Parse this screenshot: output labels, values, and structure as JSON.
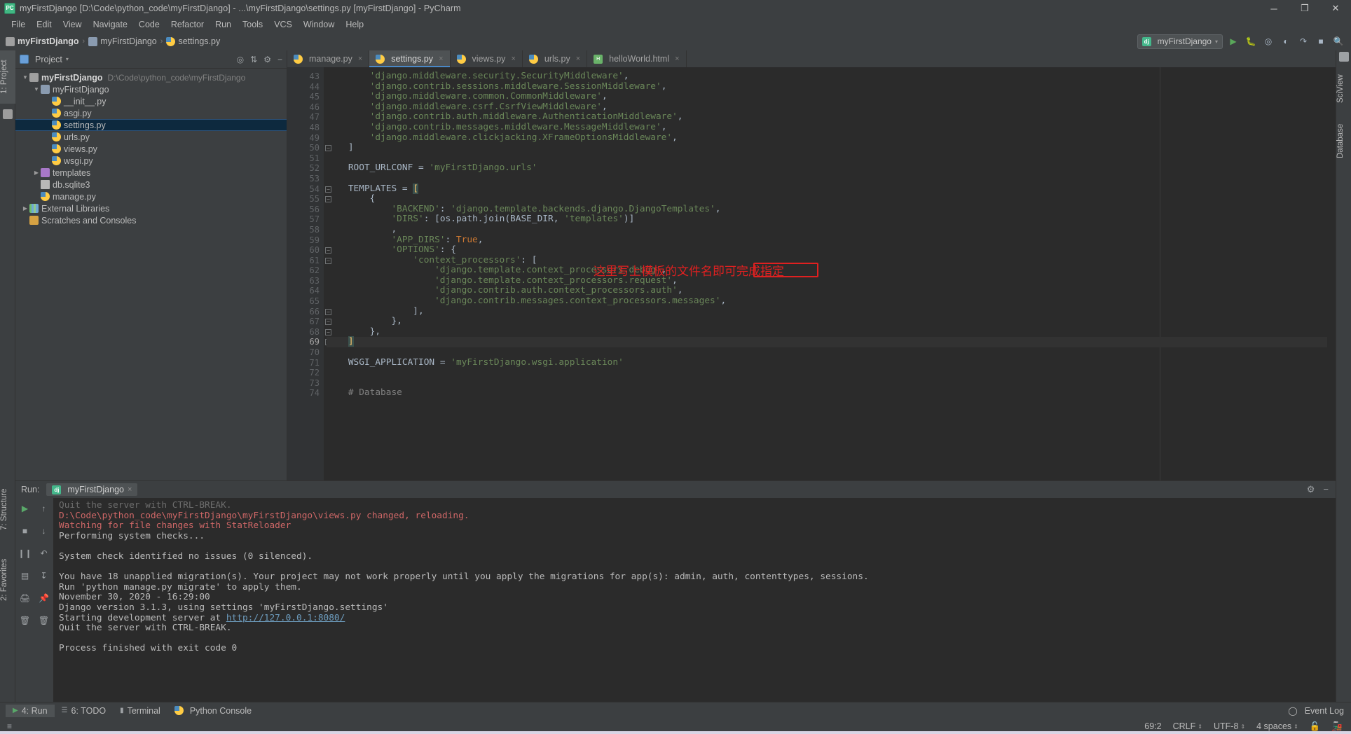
{
  "window": {
    "title": "myFirstDjango [D:\\Code\\python_code\\myFirstDjango] - ...\\myFirstDjango\\settings.py [myFirstDjango] - PyCharm",
    "app_icon": "pycharm-icon",
    "minimize": "─",
    "maximize": "❐",
    "close": "✕"
  },
  "menu": {
    "items": [
      "File",
      "Edit",
      "View",
      "Navigate",
      "Code",
      "Refactor",
      "Run",
      "Tools",
      "VCS",
      "Window",
      "Help"
    ]
  },
  "breadcrumb": {
    "items": [
      {
        "label": "myFirstDjango",
        "icon": "folder-icon"
      },
      {
        "label": "myFirstDjango",
        "icon": "module-icon"
      },
      {
        "label": "settings.py",
        "icon": "python-file-icon"
      }
    ],
    "separator": "›"
  },
  "toolbar_right": {
    "run_config": "myFirstDjango",
    "run_config_icon": "django-icon",
    "dropdown_caret": "▾",
    "icons": [
      "run-icon",
      "debug-icon",
      "coverage-icon",
      "profile-icon",
      "attach-icon",
      "stop-icon",
      "search-everywhere-icon"
    ]
  },
  "left_strip": {
    "tabs": [
      {
        "label": "1: Project",
        "selected": true
      },
      {
        "label": "2: Favorites",
        "selected": false
      },
      {
        "label": "7: Structure",
        "selected": false
      }
    ]
  },
  "right_strip": {
    "tabs": [
      {
        "label": "SciView",
        "selected": false
      },
      {
        "label": "Database",
        "selected": false
      }
    ]
  },
  "project_panel": {
    "title": "Project",
    "title_caret": "▾",
    "header_icons": [
      "target-icon",
      "collapse-all-icon",
      "settings-icon",
      "hide-icon"
    ],
    "tree": [
      {
        "indent": 0,
        "arrow": "▼",
        "icon": "folder-icon",
        "label": "myFirstDjango",
        "bold": true,
        "path": "D:\\Code\\python_code\\myFirstDjango",
        "selected": false
      },
      {
        "indent": 1,
        "arrow": "▼",
        "icon": "module-icon",
        "label": "myFirstDjango",
        "bold": false,
        "path": "",
        "selected": false
      },
      {
        "indent": 2,
        "arrow": "",
        "icon": "python-file-icon",
        "label": "__init__.py",
        "bold": false,
        "path": "",
        "selected": false
      },
      {
        "indent": 2,
        "arrow": "",
        "icon": "python-file-icon",
        "label": "asgi.py",
        "bold": false,
        "path": "",
        "selected": false
      },
      {
        "indent": 2,
        "arrow": "",
        "icon": "python-file-icon",
        "label": "settings.py",
        "bold": false,
        "path": "",
        "selected": true
      },
      {
        "indent": 2,
        "arrow": "",
        "icon": "python-file-icon",
        "label": "urls.py",
        "bold": false,
        "path": "",
        "selected": false
      },
      {
        "indent": 2,
        "arrow": "",
        "icon": "python-file-icon",
        "label": "views.py",
        "bold": false,
        "path": "",
        "selected": false
      },
      {
        "indent": 2,
        "arrow": "",
        "icon": "python-file-icon",
        "label": "wsgi.py",
        "bold": false,
        "path": "",
        "selected": false
      },
      {
        "indent": 1,
        "arrow": "▶",
        "icon": "templates-folder-icon",
        "label": "templates",
        "bold": false,
        "path": "",
        "selected": false
      },
      {
        "indent": 1,
        "arrow": "",
        "icon": "database-file-icon",
        "label": "db.sqlite3",
        "bold": false,
        "path": "",
        "selected": false
      },
      {
        "indent": 1,
        "arrow": "",
        "icon": "python-file-icon",
        "label": "manage.py",
        "bold": false,
        "path": "",
        "selected": false
      },
      {
        "indent": 0,
        "arrow": "▶",
        "icon": "library-icon",
        "label": "External Libraries",
        "bold": false,
        "path": "",
        "selected": false
      },
      {
        "indent": 0,
        "arrow": "",
        "icon": "scratches-icon",
        "label": "Scratches and Consoles",
        "bold": false,
        "path": "",
        "selected": false
      }
    ]
  },
  "editor": {
    "tabs": [
      {
        "label": "manage.py",
        "icon": "python-file-icon",
        "active": false,
        "close": "×"
      },
      {
        "label": "settings.py",
        "icon": "python-file-icon",
        "active": true,
        "close": "×"
      },
      {
        "label": "views.py",
        "icon": "python-file-icon",
        "active": false,
        "close": "×"
      },
      {
        "label": "urls.py",
        "icon": "python-file-icon",
        "active": false,
        "close": "×"
      },
      {
        "label": "helloWorld.html",
        "icon": "html-file-icon",
        "active": false,
        "close": "×"
      }
    ],
    "first_line_number": 43,
    "current_line": 69,
    "lines": [
      {
        "n": 43,
        "text": "        'django.middleware.security.SecurityMiddleware',"
      },
      {
        "n": 44,
        "text": "        'django.contrib.sessions.middleware.SessionMiddleware',"
      },
      {
        "n": 45,
        "text": "        'django.middleware.common.CommonMiddleware',"
      },
      {
        "n": 46,
        "text": "        'django.middleware.csrf.CsrfViewMiddleware',"
      },
      {
        "n": 47,
        "text": "        'django.contrib.auth.middleware.AuthenticationMiddleware',"
      },
      {
        "n": 48,
        "text": "        'django.contrib.messages.middleware.MessageMiddleware',"
      },
      {
        "n": 49,
        "text": "        'django.middleware.clickjacking.XFrameOptionsMiddleware',"
      },
      {
        "n": 50,
        "text": "    ]"
      },
      {
        "n": 51,
        "text": ""
      },
      {
        "n": 52,
        "text": "    ROOT_URLCONF = 'myFirstDjango.urls'"
      },
      {
        "n": 53,
        "text": ""
      },
      {
        "n": 54,
        "text": "    TEMPLATES = ["
      },
      {
        "n": 55,
        "text": "        {"
      },
      {
        "n": 56,
        "text": "            'BACKEND': 'django.template.backends.django.DjangoTemplates',"
      },
      {
        "n": 57,
        "text": "            'DIRS': [os.path.join(BASE_DIR, 'templates')]"
      },
      {
        "n": 58,
        "text": "            ,"
      },
      {
        "n": 59,
        "text": "            'APP_DIRS': True,"
      },
      {
        "n": 60,
        "text": "            'OPTIONS': {"
      },
      {
        "n": 61,
        "text": "                'context_processors': ["
      },
      {
        "n": 62,
        "text": "                    'django.template.context_processors.debug',"
      },
      {
        "n": 63,
        "text": "                    'django.template.context_processors.request',"
      },
      {
        "n": 64,
        "text": "                    'django.contrib.auth.context_processors.auth',"
      },
      {
        "n": 65,
        "text": "                    'django.contrib.messages.context_processors.messages',"
      },
      {
        "n": 66,
        "text": "                ],"
      },
      {
        "n": 67,
        "text": "            },"
      },
      {
        "n": 68,
        "text": "        },"
      },
      {
        "n": 69,
        "text": "    ]"
      },
      {
        "n": 70,
        "text": ""
      },
      {
        "n": 71,
        "text": "    WSGI_APPLICATION = 'myFirstDjango.wsgi.application'"
      },
      {
        "n": 72,
        "text": ""
      },
      {
        "n": 73,
        "text": ""
      },
      {
        "n": 74,
        "text": "    # Database"
      }
    ],
    "annotation": {
      "text": "这里写上模板的文件名即可完成指定",
      "color": "#e02020",
      "highlight_target": "'templates')]"
    }
  },
  "run_panel": {
    "label": "Run:",
    "tab_label": "myFirstDjango",
    "tab_icon": "django-icon",
    "tab_close": "×",
    "header_icons": [
      "settings-icon",
      "hide-icon"
    ],
    "toolbar_icons": [
      "rerun-icon",
      "stop-icon",
      "pause-icon",
      "print-icon",
      "up-icon",
      "down-icon",
      "soft-wrap-icon",
      "scroll-to-end-icon",
      "clear-all-icon"
    ],
    "console_lines": [
      {
        "text": "Quit the server with CTRL-BREAK.",
        "style": "cut"
      },
      {
        "text": "D:\\Code\\python_code\\myFirstDjango\\myFirstDjango\\views.py changed, reloading.",
        "style": "red"
      },
      {
        "text": "Watching for file changes with StatReloader",
        "style": "red"
      },
      {
        "text": "Performing system checks...",
        "style": "normal"
      },
      {
        "text": "",
        "style": "normal"
      },
      {
        "text": "System check identified no issues (0 silenced).",
        "style": "normal"
      },
      {
        "text": "",
        "style": "normal"
      },
      {
        "text": "You have 18 unapplied migration(s). Your project may not work properly until you apply the migrations for app(s): admin, auth, contenttypes, sessions.",
        "style": "normal"
      },
      {
        "text": "Run 'python manage.py migrate' to apply them.",
        "style": "normal"
      },
      {
        "text": "November 30, 2020 - 16:29:00",
        "style": "normal"
      },
      {
        "text": "Django version 3.1.3, using settings 'myFirstDjango.settings'",
        "style": "normal"
      },
      {
        "text": "Starting development server at http://127.0.0.1:8080/",
        "style": "link",
        "prefix": "Starting development server at ",
        "link": "http://127.0.0.1:8080/"
      },
      {
        "text": "Quit the server with CTRL-BREAK.",
        "style": "normal"
      },
      {
        "text": "",
        "style": "normal"
      },
      {
        "text": "Process finished with exit code 0",
        "style": "normal"
      }
    ]
  },
  "bottom_bar": {
    "items": [
      {
        "label": "4: Run",
        "icon": "run-icon",
        "selected": true
      },
      {
        "label": "6: TODO",
        "icon": "todo-icon",
        "selected": false
      },
      {
        "label": "Terminal",
        "icon": "terminal-icon",
        "selected": false
      },
      {
        "label": "Python Console",
        "icon": "python-console-icon",
        "selected": false
      }
    ],
    "event_log": "Event Log",
    "event_log_icon": "event-log-icon"
  },
  "status_bar": {
    "caret_position": "69:2",
    "line_separator": "CRLF",
    "encoding": "UTF-8",
    "indent": "4 spaces",
    "lock_icon": "unlocked-icon",
    "train_icon": "git-branch-icon",
    "caret": "≡"
  }
}
